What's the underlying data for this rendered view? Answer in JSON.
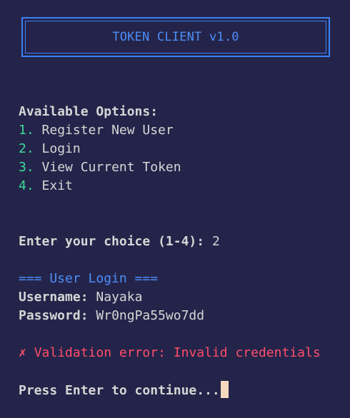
{
  "title": "TOKEN CLIENT v1.0",
  "menu": {
    "heading": "Available Options:",
    "items": [
      {
        "num": "1.",
        "label": "Register New User"
      },
      {
        "num": "2.",
        "label": "Login"
      },
      {
        "num": "3.",
        "label": "View Current Token"
      },
      {
        "num": "4.",
        "label": "Exit"
      }
    ]
  },
  "prompt": {
    "label": "Enter your choice (1-4):",
    "value": "2"
  },
  "login": {
    "heading": "=== User Login ===",
    "username_label": "Username:",
    "username_value": "Nayaka",
    "password_label": "Password:",
    "password_value": "Wr0ngPa55wo7dd"
  },
  "error": {
    "icon": "✗",
    "message": "Validation error: Invalid credentials"
  },
  "continue_prompt": "Press Enter to continue...",
  "colors": {
    "background": "#24244a",
    "accent_blue": "#4d8ef7",
    "menu_number_green": "#3ddc97",
    "error_red": "#ff4d6a",
    "cursor": "#f5d9bf"
  }
}
